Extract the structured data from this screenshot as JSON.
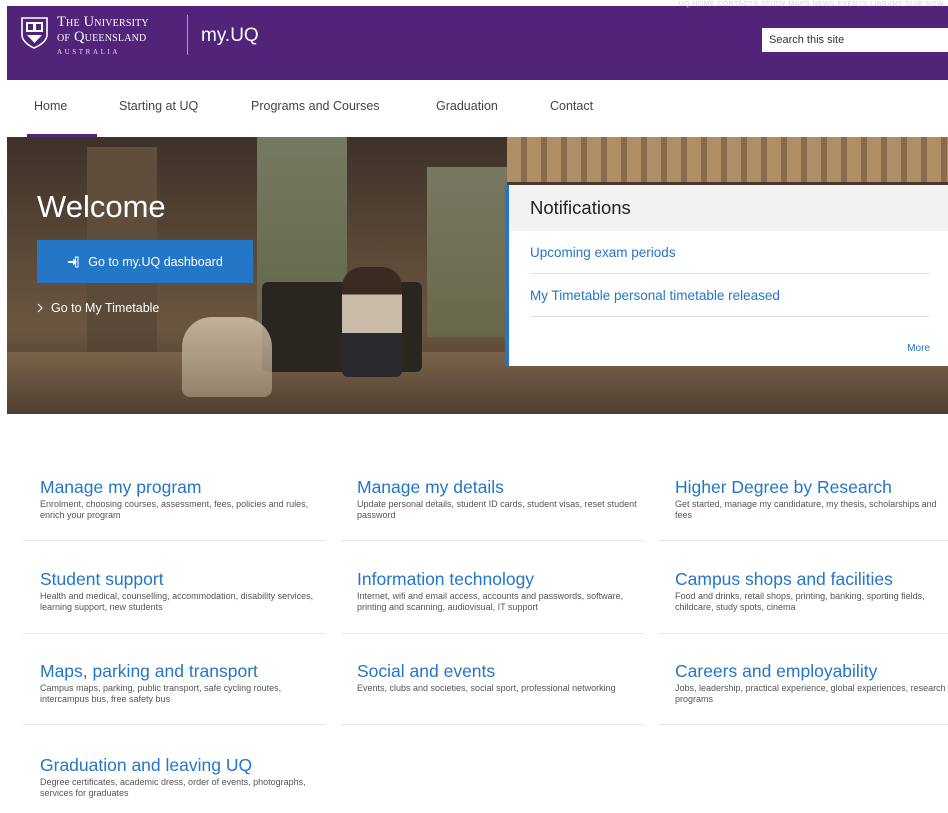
{
  "header": {
    "university_line1": "The University",
    "university_line2": "of Queensland",
    "university_line3": "AUSTRALIA",
    "site_name": "my.UQ",
    "utility_links": "UQ HOME  CONTACTS  STUDY  MAPS  NEWS  EVENTS  LIBRARY  GIVE NOW",
    "search_placeholder": "Search this site",
    "brand_color": "#51247a"
  },
  "nav": {
    "items": [
      {
        "label": "Home"
      },
      {
        "label": "Starting at UQ"
      },
      {
        "label": "Programs and Courses"
      },
      {
        "label": "Graduation"
      },
      {
        "label": "Contact"
      }
    ]
  },
  "hero": {
    "welcome": "Welcome",
    "dashboard_button": "Go to my.UQ dashboard",
    "timetable_link": "Go to My Timetable",
    "accent_color": "#2476c6"
  },
  "notifications": {
    "title": "Notifications",
    "items": [
      {
        "label": "Upcoming exam periods"
      },
      {
        "label": "My Timetable personal timetable released"
      }
    ],
    "more": "More"
  },
  "cards": [
    {
      "title": "Manage my program",
      "desc": "Enrolment, choosing courses, assessment, fees, policies and rules, enrich your program"
    },
    {
      "title": "Manage my details",
      "desc": "Update personal details, student ID cards, student visas, reset student password"
    },
    {
      "title": "Higher Degree by Research",
      "desc": "Get started, manage my candidature, my thesis, scholarships and fees"
    },
    {
      "title": "Student support",
      "desc": "Health and medical, counselling, accommodation, disability services, learning support, new students"
    },
    {
      "title": "Information technology",
      "desc": "Internet, wifi and email access, accounts and passwords, software, printing and scanning, audiovisual, IT support"
    },
    {
      "title": "Campus shops and facilities",
      "desc": "Food and drinks, retail shops, printing, banking, sporting fields, childcare, study spots, cinema"
    },
    {
      "title": "Maps, parking and transport",
      "desc": "Campus maps, parking, public transport, safe cycling routes, intercampus bus, free safety bus"
    },
    {
      "title": "Social and events",
      "desc": "Events, clubs and societies, social sport, professional networking"
    },
    {
      "title": "Careers and employability",
      "desc": "Jobs, leadership, practical experience, global experiences, research programs"
    },
    {
      "title": "Graduation and leaving UQ",
      "desc": "Degree certificates, academic dress, order of events, photographs, services for graduates"
    }
  ]
}
